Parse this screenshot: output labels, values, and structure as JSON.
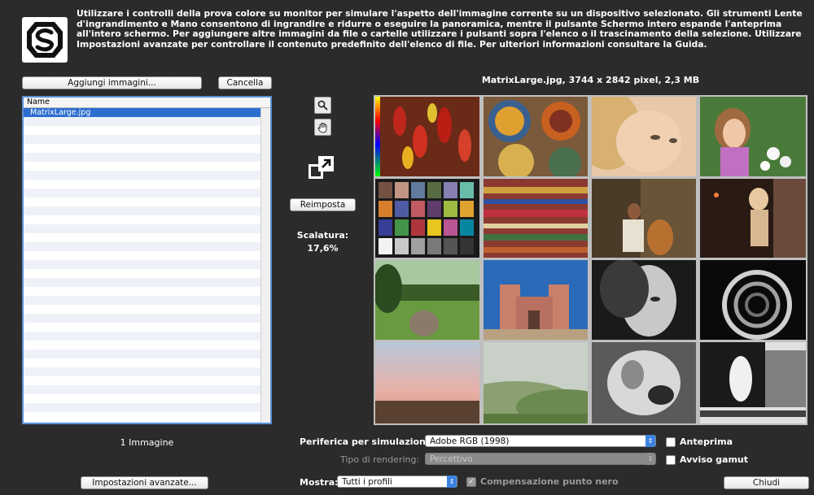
{
  "header": {
    "intro_text": "Utilizzare i controlli della prova colore su monitor per simulare l'aspetto dell'immagine corrente su un dispositivo selezionato. Gli strumenti Lente d'ingrandimento e Mano consentono di ingrandire e ridurre o eseguire la panoramica, mentre il pulsante Schermo intero espande l'anteprima all'intero schermo. Per aggiungere altre immagini da file o cartelle utilizzare i pulsanti sopra l'elenco o il trascinamento della selezione. Utilizzare Impostazioni avanzate per controllare il contenuto predefinito dell'elenco di file. Per ulteriori informazioni consultare la Guida."
  },
  "file_panel": {
    "add_button": "Aggiungi immagini...",
    "clear_button": "Cancella",
    "column_header": "Name",
    "files": [
      "MatrixLarge.jpg"
    ],
    "count_label": "1 Immagine",
    "advanced_button": "Impostazioni avanzate..."
  },
  "tools": {
    "zoom_icon": "magnifier-icon",
    "hand_icon": "hand-icon",
    "fullscreen_icon": "fullscreen-icon",
    "reset_button": "Reimposta",
    "scale_label": "Scalatura:",
    "scale_value": "17,6%"
  },
  "preview": {
    "image_info": "MatrixLarge.jpg, 3744 x 2842 pixel, 2,3 MB",
    "thumbnails": [
      "chili-peppers",
      "ceramic-plates",
      "woman-face",
      "girl-flowers",
      "color-checker",
      "woven-fabric",
      "cellist",
      "statue-lights",
      "garden-urn",
      "adobe-church",
      "bw-portrait",
      "spiral-staircase",
      "pink-sky",
      "green-hills",
      "bw-sculpture",
      "bw-test-chart"
    ]
  },
  "controls": {
    "device_label": "Periferica per simulazione:",
    "device_value": "Adobe RGB (1998)",
    "rendering_label": "Tipo di rendering:",
    "rendering_value": "Percettivo",
    "show_label": "Mostra:",
    "show_value": "Tutti i profili",
    "black_point_label": "Compensazione punto nero",
    "preview_label": "Anteprima",
    "gamut_label": "Avviso gamut",
    "close_button": "Chiudi"
  },
  "colors": {
    "accent": "#3b83e0",
    "selection": "#2c6ed0",
    "background": "#2b2b2b"
  }
}
